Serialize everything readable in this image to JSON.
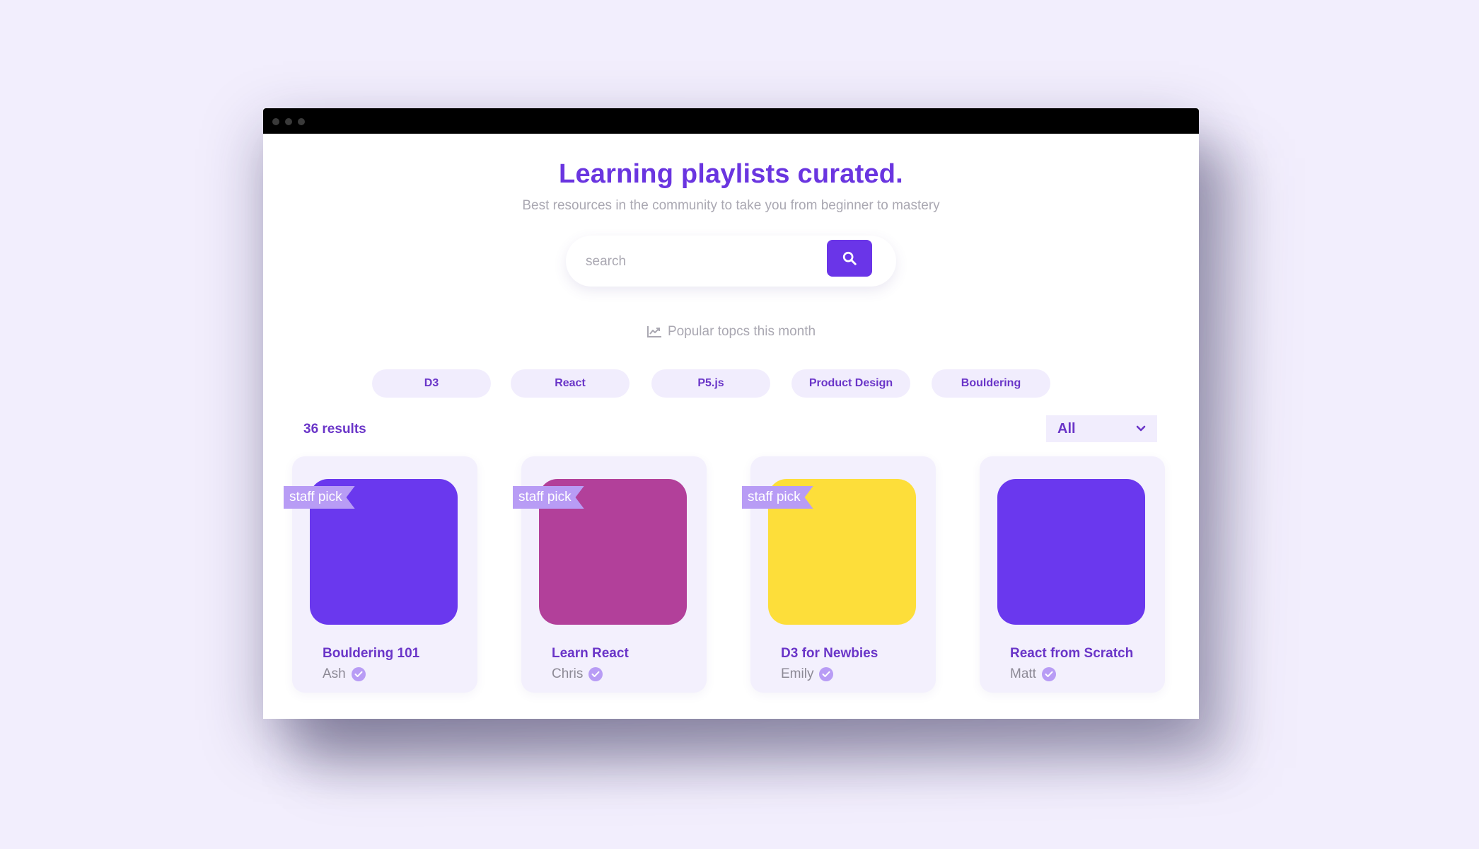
{
  "hero": {
    "title": "Learning playlists curated.",
    "subtitle": "Best resources in the community to take you from beginner to mastery"
  },
  "search": {
    "placeholder": "search",
    "button_icon": "search-icon"
  },
  "popular": {
    "icon": "trending-chart-icon",
    "label": "Popular topcs this month"
  },
  "chips": [
    {
      "label": "D3"
    },
    {
      "label": "React"
    },
    {
      "label": "P5.js"
    },
    {
      "label": "Product Design"
    },
    {
      "label": "Bouldering"
    }
  ],
  "results": {
    "count_label": "36 results"
  },
  "filter": {
    "selected": "All",
    "icon": "chevron-down-icon"
  },
  "cards": [
    {
      "title": "Bouldering 101",
      "author": "Ash",
      "badge": "staff pick",
      "color": "#6a38ee"
    },
    {
      "title": "Learn React",
      "author": "Chris",
      "badge": "staff pick",
      "color": "#b2409a"
    },
    {
      "title": "D3 for Newbies",
      "author": "Emily",
      "badge": "staff pick",
      "color": "#fdde3a"
    },
    {
      "title": "React from Scratch",
      "author": "Matt",
      "badge": "",
      "color": "#6a38ee"
    }
  ],
  "colors": {
    "accent": "#6a35e8",
    "background": "#f2eefd",
    "chip_bg": "#f1edfd",
    "badge": "#b89cf5"
  }
}
